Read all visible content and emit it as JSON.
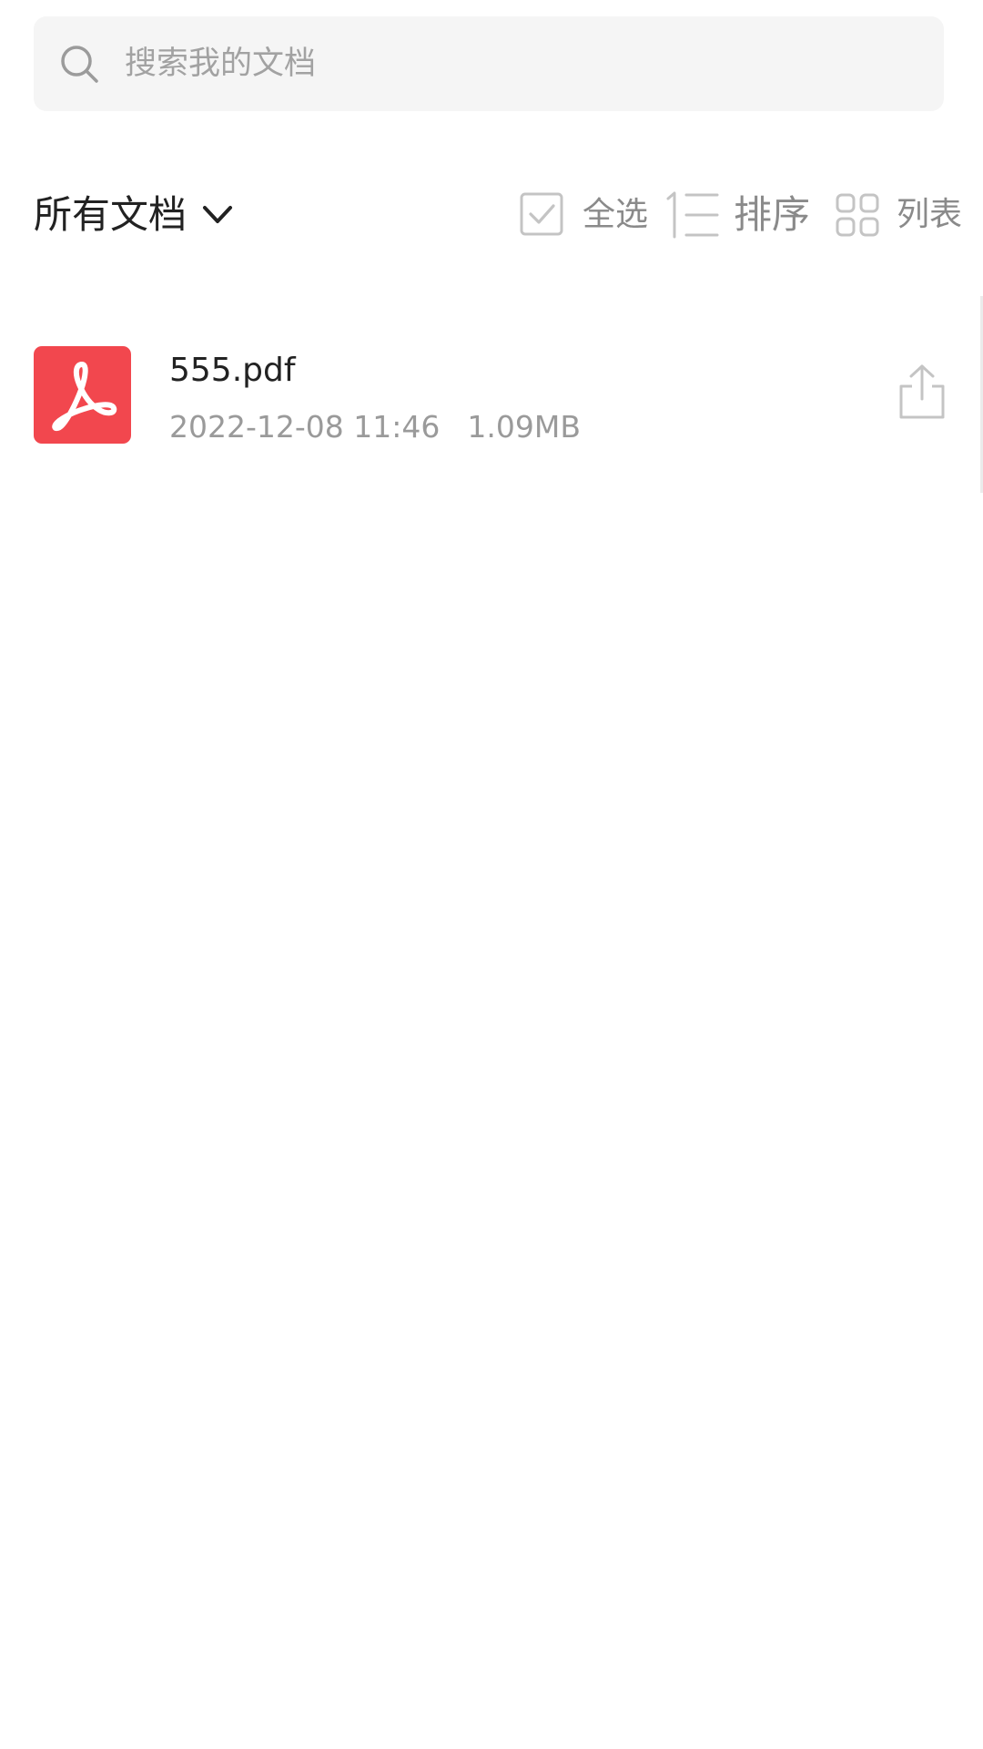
{
  "search": {
    "placeholder": "搜索我的文档"
  },
  "toolbar": {
    "filter_label": "所有文档",
    "select_all_label": "全选",
    "sort_label": "排序",
    "view_label": "列表"
  },
  "files": [
    {
      "name": "555.pdf",
      "date": "2022-12-08 11:46",
      "size": "1.09MB",
      "icon": "pdf-icon"
    }
  ],
  "colors": {
    "pdf_red": "#f2474e",
    "search_bg": "#f5f5f5",
    "text_primary": "#222222",
    "text_secondary": "#9a9a9a"
  }
}
